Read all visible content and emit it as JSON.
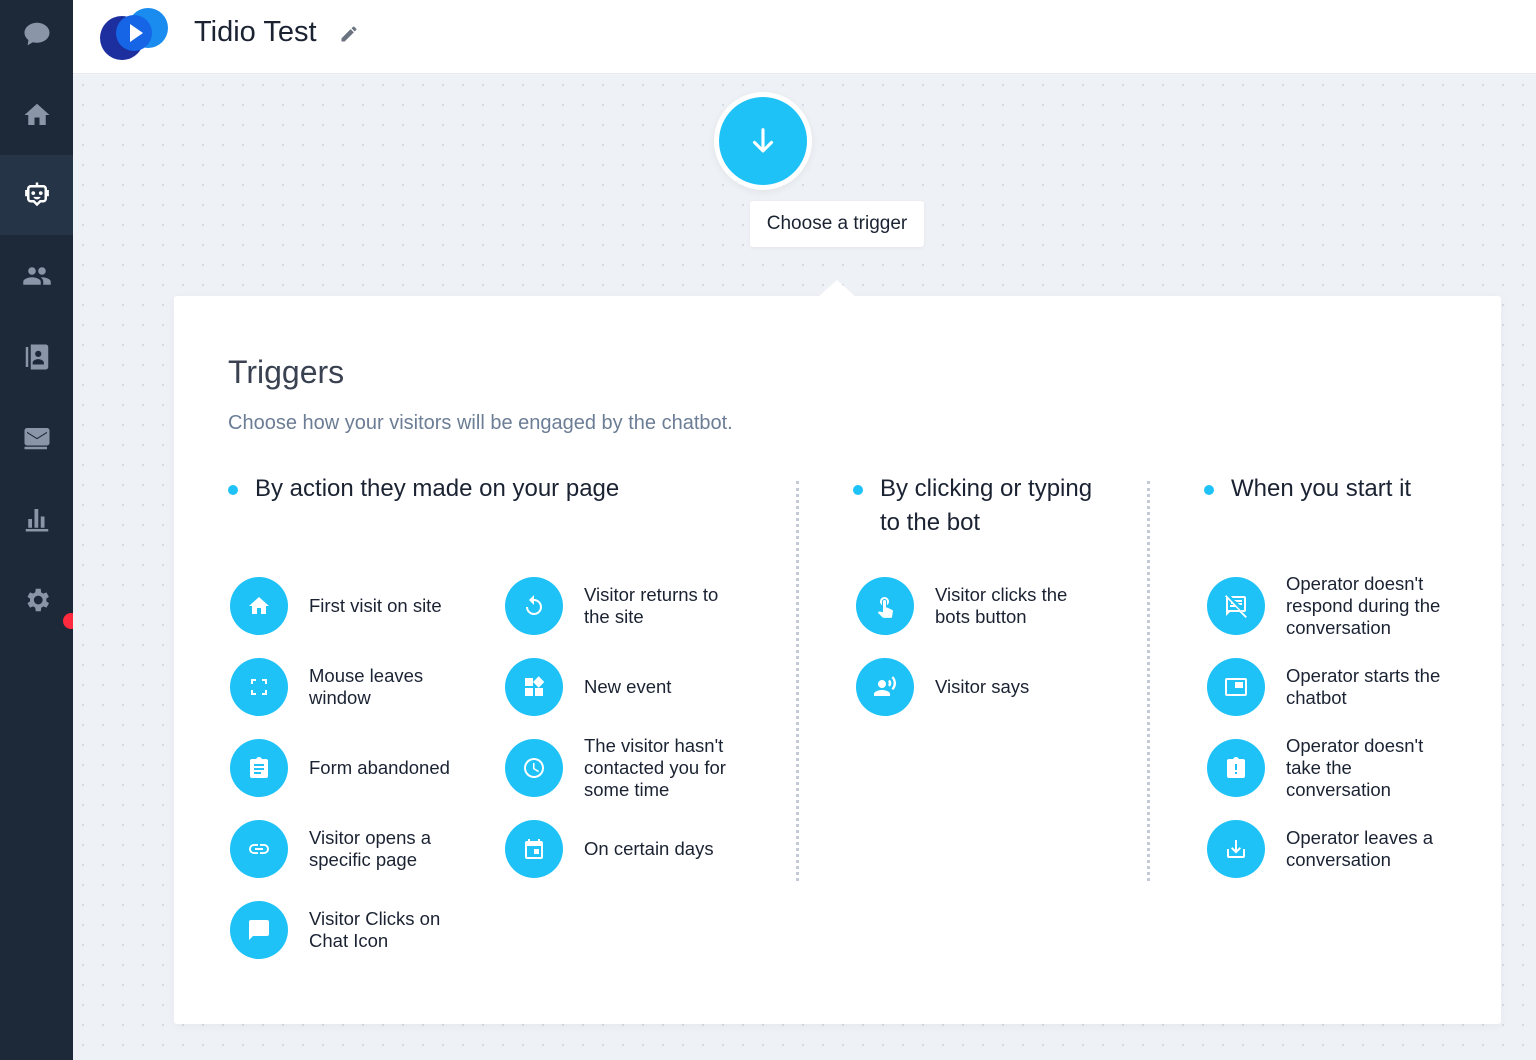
{
  "header": {
    "title": "Tidio Test"
  },
  "sidebar": {
    "items": [
      {
        "name": "chat",
        "icon": "chat-bubble-icon"
      },
      {
        "name": "home",
        "icon": "home-icon"
      },
      {
        "name": "bots",
        "icon": "bot-icon",
        "active": true
      },
      {
        "name": "visitors",
        "icon": "people-icon"
      },
      {
        "name": "contacts",
        "icon": "contacts-icon"
      },
      {
        "name": "mailing",
        "icon": "mail-icon"
      },
      {
        "name": "analytics",
        "icon": "bar-chart-icon"
      },
      {
        "name": "settings",
        "icon": "gear-icon"
      }
    ]
  },
  "canvas": {
    "choose_trigger_label": "Choose a trigger"
  },
  "panel": {
    "title": "Triggers",
    "subtitle": "Choose how your visitors will be engaged by the chatbot.",
    "sections": [
      {
        "heading_line1": "By action they made on your page",
        "items": [
          {
            "label": "First visit on site",
            "icon": "home-icon"
          },
          {
            "label": "Mouse leaves window",
            "icon": "fullscreen-icon"
          },
          {
            "label": "Form abandoned",
            "icon": "clipboard-icon"
          },
          {
            "label": "Visitor opens a specific page",
            "icon": "link-icon"
          },
          {
            "label": "Visitor Clicks on Chat Icon",
            "icon": "chat-bubble-icon"
          },
          {
            "label": "Visitor returns to the site",
            "icon": "return-icon"
          },
          {
            "label": "New event",
            "icon": "widgets-icon"
          },
          {
            "label": "The visitor hasn't contacted you for some time",
            "icon": "clock-icon"
          },
          {
            "label": "On certain days",
            "icon": "calendar-icon"
          }
        ]
      },
      {
        "heading_line1": "By clicking or typing",
        "heading_line2": "to the bot",
        "items": [
          {
            "label": "Visitor clicks the bots button",
            "icon": "tap-icon"
          },
          {
            "label": "Visitor says",
            "icon": "voice-icon"
          }
        ]
      },
      {
        "heading_line1": "When you start it",
        "items": [
          {
            "label": "Operator doesn't respond during the conversation",
            "icon": "no-reply-icon"
          },
          {
            "label": "Operator starts the chatbot",
            "icon": "window-icon"
          },
          {
            "label": "Operator doesn't take the conversation",
            "icon": "alert-clipboard-icon"
          },
          {
            "label": "Operator leaves a conversation",
            "icon": "download-tray-icon"
          }
        ]
      }
    ]
  },
  "colors": {
    "accent": "#1ec2f7",
    "sidebar": "#1d2838",
    "notification": "#ff2a3d"
  }
}
